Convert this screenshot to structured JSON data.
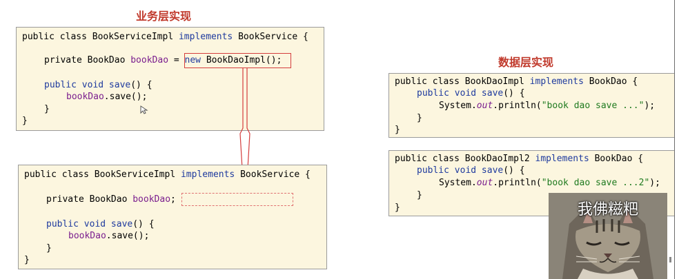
{
  "business": {
    "title": "业务层实现",
    "box1": {
      "line1": [
        "public class BookServiceImpl ",
        "implements",
        " BookService {"
      ],
      "line2": [
        "private BookDao ",
        "bookDao",
        " = ",
        "new",
        " BookDaoImpl();"
      ],
      "line3": [
        "public void ",
        "save",
        "() {"
      ],
      "line4": [
        "bookDao",
        ".save();"
      ],
      "line5": "}",
      "line6": "}"
    },
    "box2": {
      "line1": [
        "public class BookServiceImpl ",
        "implements",
        " BookService {"
      ],
      "line2": [
        "private BookDao ",
        "bookDao",
        ";"
      ],
      "line3": [
        "public void ",
        "save",
        "() {"
      ],
      "line4": [
        "bookDao",
        ".save();"
      ],
      "line5": "}",
      "line6": "}"
    }
  },
  "data_layer": {
    "title": "数据层实现",
    "box1": {
      "line1": [
        "public class BookDaoImpl ",
        "implements",
        " BookDao {"
      ],
      "line2": [
        "public void ",
        "save",
        "() {"
      ],
      "line3": [
        "System.",
        "out",
        ".println(",
        "\"book dao save ...\"",
        ");"
      ],
      "line4": "}",
      "line5": "}"
    },
    "box2": {
      "line1": [
        "public class BookDaoImpl2 ",
        "implements",
        " BookDao {"
      ],
      "line2": [
        "public void ",
        "save",
        "() {"
      ],
      "line3": [
        "System.",
        "out",
        ".println(",
        "\"book dao save ...2\"",
        ");"
      ],
      "line4": "}",
      "line5": "}"
    }
  },
  "sticker": {
    "caption": "我佛糍粑"
  },
  "colors": {
    "title_red": "#c0392b",
    "keyword_blue": "#1e3a9e",
    "field_purple": "#7a1e8e",
    "string_green": "#1f7a1f",
    "highlight_red": "#d43c3c",
    "code_bg": "#fcf6df"
  }
}
